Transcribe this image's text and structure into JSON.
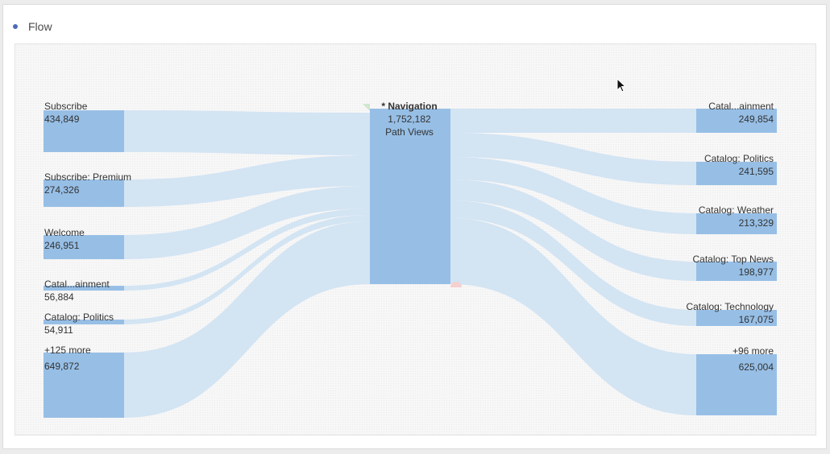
{
  "panel": {
    "title": "Flow"
  },
  "colors": {
    "node": "#97bfe6",
    "link": "#d3e4f3",
    "dot": "#4b6bb7"
  },
  "focus": {
    "name": "* Navigation",
    "value": "1,752,182",
    "unit": "Path Views"
  },
  "left_nodes": [
    {
      "name": "Subscribe",
      "value": "434,849"
    },
    {
      "name": "Subscribe: Premium",
      "value": "274,326"
    },
    {
      "name": "Welcome",
      "value": "246,951"
    },
    {
      "name": "Catal...ainment",
      "value": "56,884"
    },
    {
      "name": "Catalog: Politics",
      "value": "54,911"
    },
    {
      "name": "+125 more",
      "value": "649,872"
    }
  ],
  "right_nodes": [
    {
      "name": "Catal...ainment",
      "value": "249,854"
    },
    {
      "name": "Catalog: Politics",
      "value": "241,595"
    },
    {
      "name": "Catalog: Weather",
      "value": "213,329"
    },
    {
      "name": "Catalog: Top News",
      "value": "198,977"
    },
    {
      "name": "Catalog: Technology",
      "value": "167,075"
    },
    {
      "name": "+96 more",
      "value": "625,004"
    }
  ]
}
